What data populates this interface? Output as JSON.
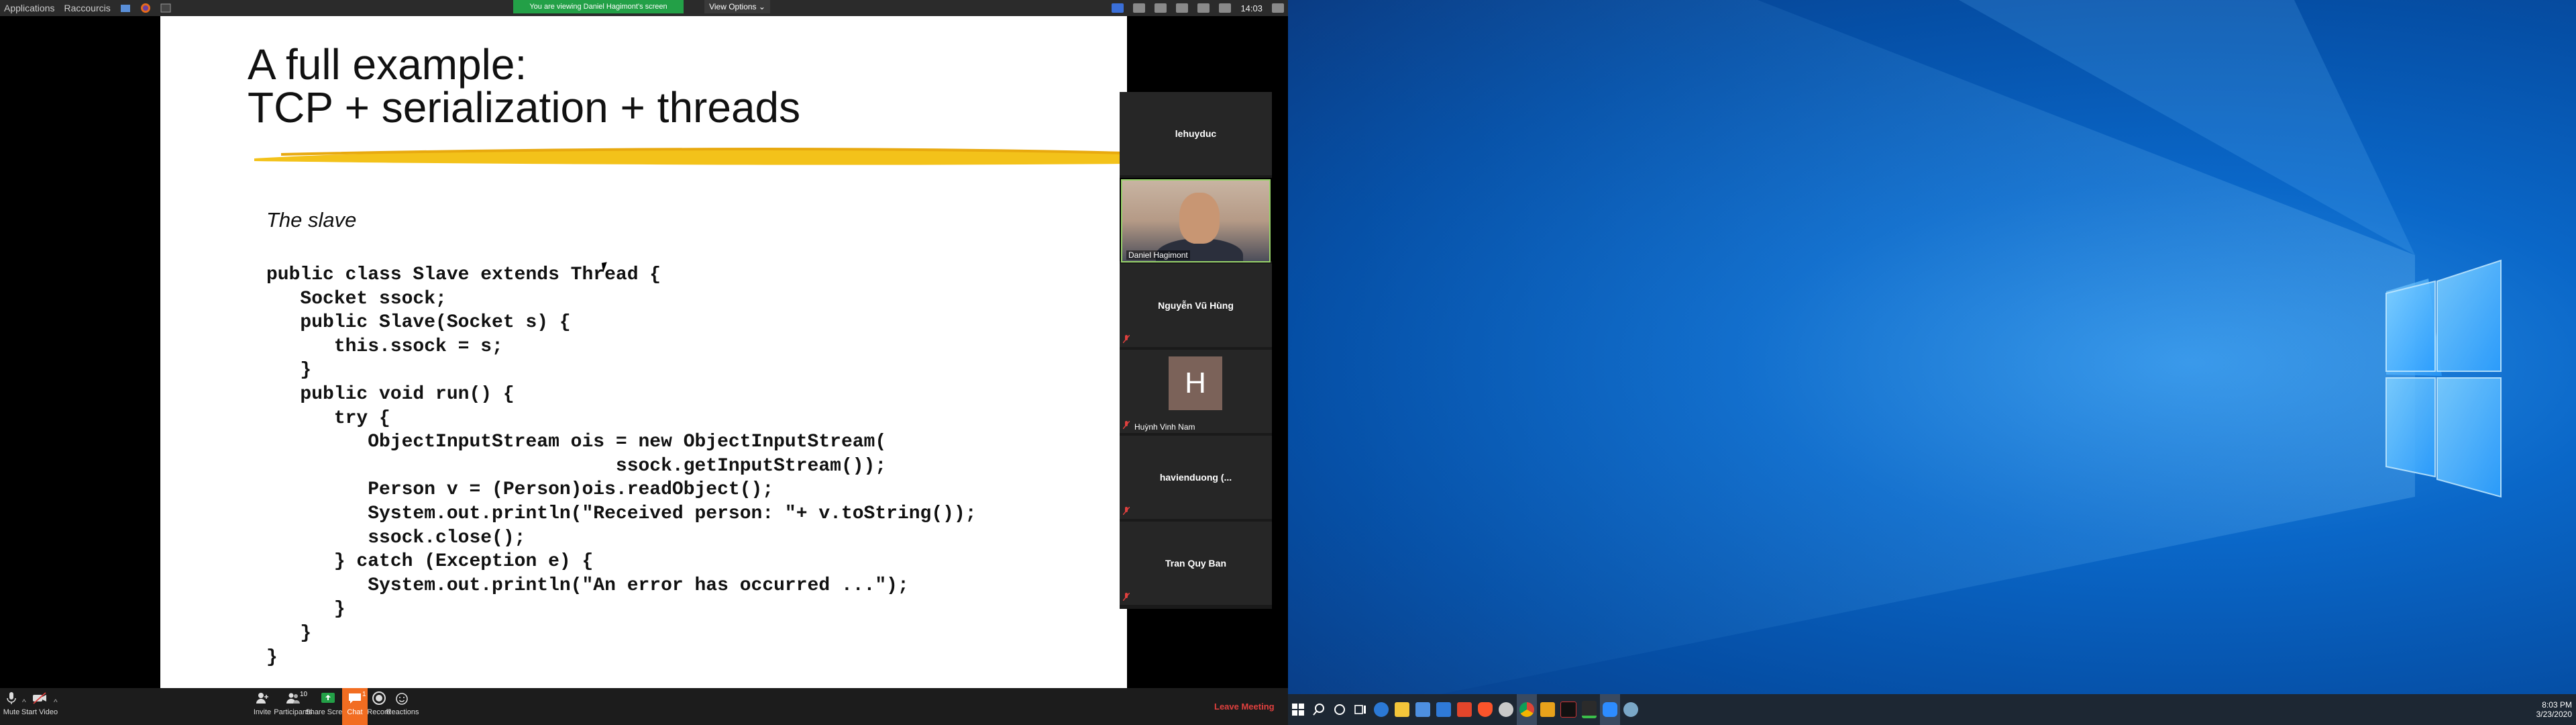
{
  "topbar": {
    "menu_applications": "Applications",
    "menu_shortcuts": "Raccourcis",
    "share_banner": "You are viewing Daniel Hagimont's screen",
    "view_options": "View Options",
    "clock": "14:03"
  },
  "slide": {
    "title_line1": "A full example:",
    "title_line2": "TCP + serialization + threads",
    "subtitle": "The slave",
    "code": "public class Slave extends Thread {\n   Socket ssock;\n   public Slave(Socket s) {\n      this.ssock = s;\n   }\n   public void run() {\n      try {\n         ObjectInputStream ois = new ObjectInputStream(\n                               ssock.getInputStream());\n         Person v = (Person)ois.readObject();\n         System.out.println(\"Received person: \"+ v.toString());\n         ssock.close();\n      } catch (Exception e) {\n         System.out.println(\"An error has occurred ...\");\n      }\n   }\n}"
  },
  "participants": [
    {
      "name": "lehuyduc"
    },
    {
      "name": "Daniel Hagimont"
    },
    {
      "name": "Nguyễn Vũ Hùng"
    },
    {
      "name": "Huỳnh Vinh Nam",
      "initial": "H"
    },
    {
      "name": "havienduong (..."
    },
    {
      "name": "Tran Quy Ban"
    }
  ],
  "zoom_toolbar": {
    "mute": "Mute",
    "start_video": "Start Video",
    "invite": "Invite",
    "participants": "Participants",
    "participants_count": "10",
    "share_screen": "Share Screen",
    "chat": "Chat",
    "chat_badge": "1",
    "record": "Record",
    "reactions": "Reactions",
    "leave": "Leave Meeting"
  },
  "taskbar": {
    "time": "8:03 PM",
    "date": "3/23/2020",
    "icons": [
      "windows-start-icon",
      "search-icon",
      "cortana-icon",
      "task-view-icon",
      "edge-icon",
      "file-explorer-icon",
      "store-icon",
      "mail-icon",
      "office-icon",
      "brave-icon",
      "settings-icon",
      "chrome-icon",
      "remote-icon",
      "terminal-icon",
      "app-icon",
      "zoom-icon",
      "network-icon"
    ]
  },
  "colors": {
    "share_green": "#23a047",
    "chat_orange": "#f26d21",
    "leave_red": "#e0403e",
    "win_blue": "#0a67c8"
  }
}
